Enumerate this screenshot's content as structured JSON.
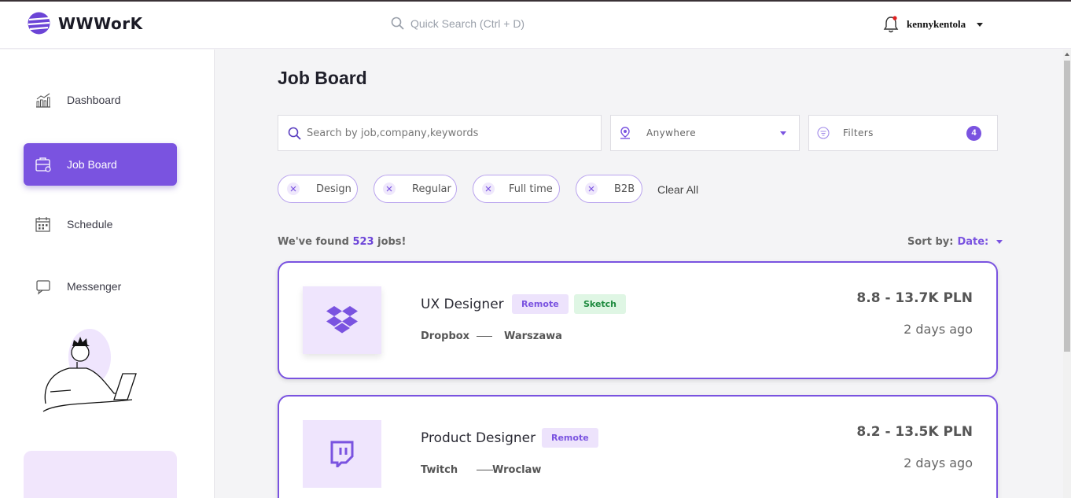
{
  "app": {
    "logo_text": "WWWorK",
    "search_placeholder": "Quick Search (Ctrl + D)",
    "username": "kennykentola"
  },
  "sidebar": {
    "items": [
      {
        "label": "Dashboard",
        "icon": "dashboard-chart-icon",
        "active": false
      },
      {
        "label": "Job Board",
        "icon": "briefcase-icon",
        "active": true
      },
      {
        "label": "Schedule",
        "icon": "calendar-icon",
        "active": false
      },
      {
        "label": "Messenger",
        "icon": "chat-icon",
        "active": false
      }
    ]
  },
  "main": {
    "title": "Job Board",
    "search_placeholder": "Search by job,company,keywords",
    "location_value": "Anywhere",
    "filters_label": "Filters",
    "filters_count": "4",
    "chips": [
      "Design",
      "Regular",
      "Full time",
      "B2B"
    ],
    "clear_all": "Clear All",
    "found_prefix": "We've found",
    "found_count": "523",
    "found_suffix": "jobs!",
    "sort_label": "Sort by:",
    "sort_value": "Date:"
  },
  "jobs": [
    {
      "title": "UX Designer",
      "tags": [
        "Remote",
        "Sketch"
      ],
      "company": "Dropbox",
      "city": "Warszawa",
      "salary": "8.8 - 13.7K PLN",
      "posted": "2 days ago",
      "logo_icon": "dropbox-icon"
    },
    {
      "title": "Product Designer",
      "tags": [
        "Remote"
      ],
      "company": "Twitch",
      "city": "Wroclaw",
      "salary": "8.2 - 13.5K PLN",
      "posted": "2 days ago",
      "logo_icon": "twitch-icon"
    }
  ],
  "colors": {
    "accent": "#7a53e0",
    "accent_light": "#efe5fd",
    "tag_green_bg": "#dff6e4",
    "tag_green_text": "#1d8a3e"
  }
}
